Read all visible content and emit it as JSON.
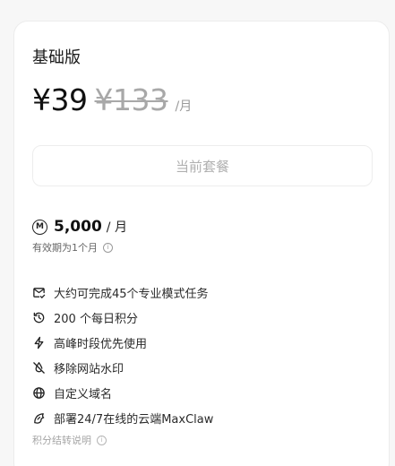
{
  "plan": {
    "name": "基础版",
    "price": "¥39",
    "original_price": "¥133",
    "period": "/月",
    "current_button_label": "当前套餐"
  },
  "credits": {
    "icon": "credit-coin-icon",
    "icon_glyph": "M",
    "amount": "5,000",
    "unit": "/ 月",
    "validity": "有效期为1个月"
  },
  "features": [
    {
      "icon": "mail-check-icon",
      "label": "大约可完成45个专业模式任务"
    },
    {
      "icon": "history-icon",
      "label": "200 个每日积分"
    },
    {
      "icon": "lightning-icon",
      "label": "高峰时段优先使用"
    },
    {
      "icon": "no-watermark-icon",
      "label": "移除网站水印"
    },
    {
      "icon": "globe-icon",
      "label": "自定义域名"
    },
    {
      "icon": "claw-icon",
      "label": "部署24/7在线的云端MaxClaw"
    }
  ],
  "footnote": "积分结转说明",
  "colors": {
    "text": "#1f1f1f",
    "muted": "#a8a8a8",
    "card_border": "#ececec"
  }
}
